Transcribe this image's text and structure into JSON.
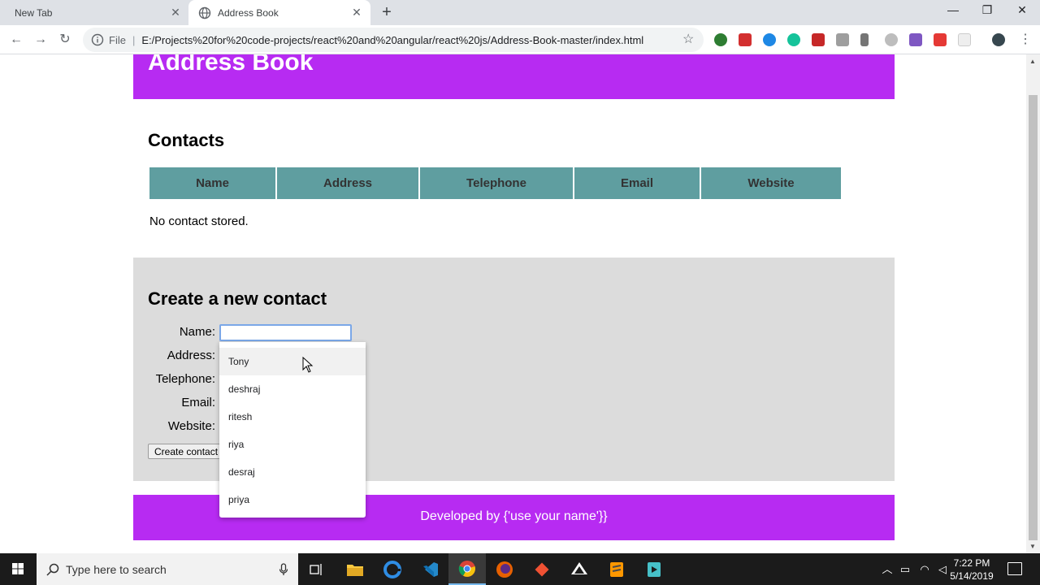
{
  "browser": {
    "tabs": [
      {
        "title": "New Tab"
      },
      {
        "title": "Address Book"
      }
    ],
    "omnibox": {
      "scheme_label": "File",
      "url": "E:/Projects%20for%20code-projects/react%20and%20angular/react%20js/Address-Book-master/index.html"
    }
  },
  "page": {
    "header_title": "Address Book",
    "contacts_title": "Contacts",
    "table_headers": [
      "Name",
      "Address",
      "Telephone",
      "Email",
      "Website"
    ],
    "empty_message": "No contact stored.",
    "create_title": "Create a new contact",
    "form": {
      "labels": [
        "Name:",
        "Address:",
        "Telephone:",
        "Email:",
        "Website:"
      ],
      "name_value": "",
      "submit_label": "Create contact"
    },
    "autocomplete": [
      "Tony",
      "deshraj",
      "ritesh",
      "riya",
      "desraj",
      "priya"
    ],
    "footer_text": "Developed by {'use your name'}}"
  },
  "taskbar": {
    "search_placeholder": "Type here to search",
    "time": "7:22 PM",
    "date": "5/14/2019"
  },
  "colors": {
    "header_bg": "#b72bf2",
    "table_header_bg": "#5f9ea0",
    "section_bg": "#dcdcdc"
  }
}
